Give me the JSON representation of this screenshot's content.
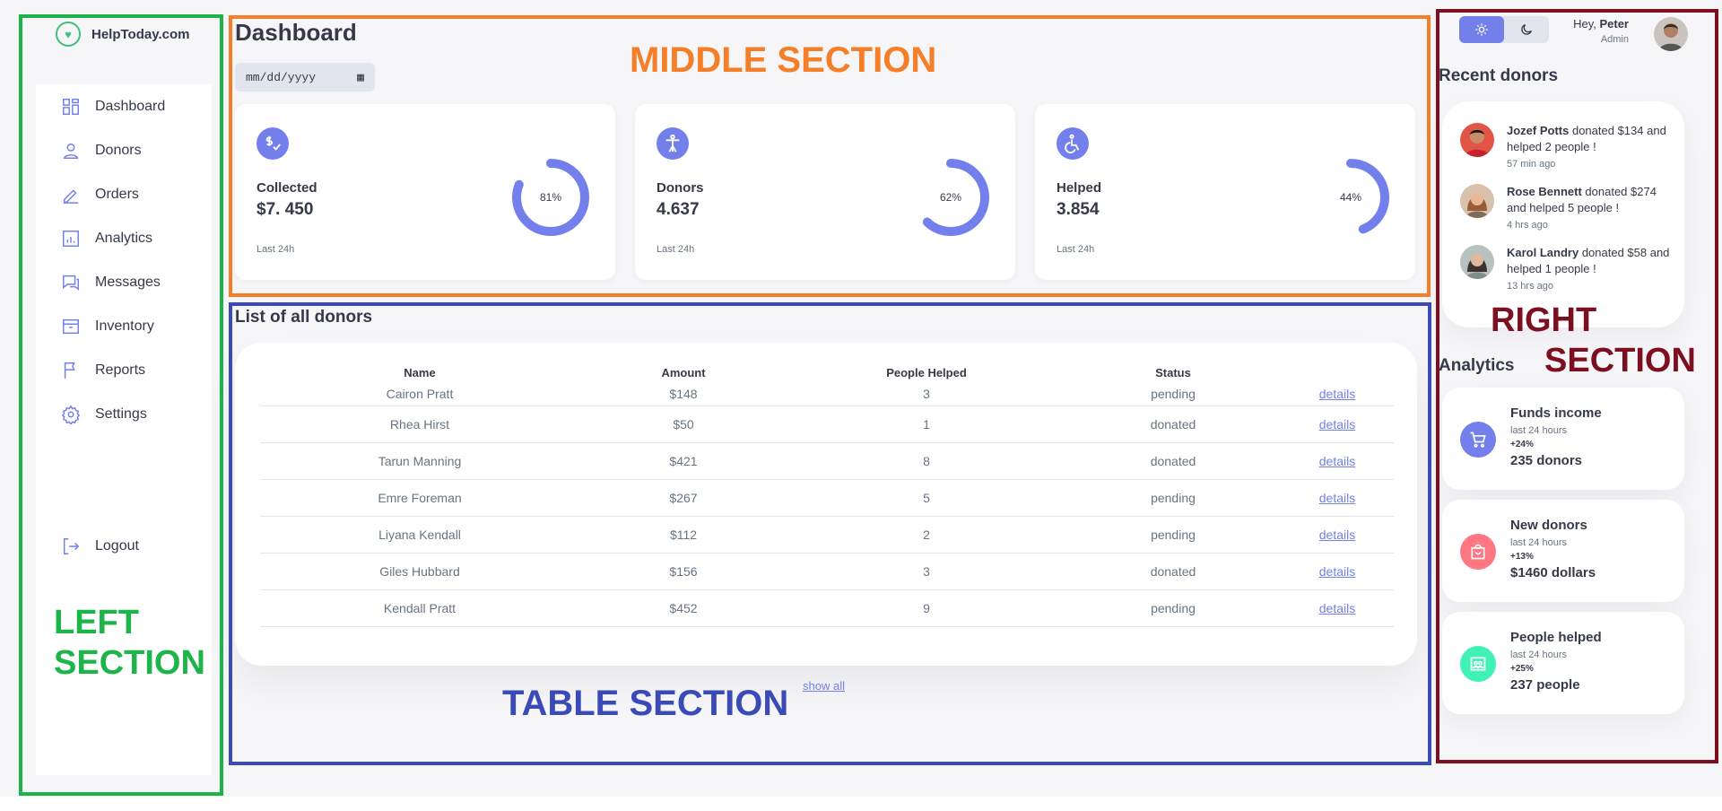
{
  "section_labels": {
    "left": "LEFT SECTION",
    "middle": "MIDDLE SECTION",
    "table": "TABLE SECTION",
    "right_line1": "RIGHT",
    "right_line2": "SECTION"
  },
  "brand": {
    "name": "HelpToday.com"
  },
  "sidebar": {
    "items": [
      {
        "label": "Dashboard",
        "icon": "grid-icon"
      },
      {
        "label": "Donors",
        "icon": "person-icon"
      },
      {
        "label": "Orders",
        "icon": "edit-icon"
      },
      {
        "label": "Analytics",
        "icon": "bar-chart-icon"
      },
      {
        "label": "Messages",
        "icon": "chat-icon"
      },
      {
        "label": "Inventory",
        "icon": "archive-icon"
      },
      {
        "label": "Reports",
        "icon": "flag-icon"
      },
      {
        "label": "Settings",
        "icon": "gear-icon"
      }
    ],
    "logout": "Logout"
  },
  "main": {
    "title": "Dashboard",
    "date_placeholder": "mm/dd/yyyy",
    "cards": [
      {
        "title": "Collected",
        "value": "$7. 450",
        "percent": 81,
        "percent_label": "81%",
        "footer": "Last 24h"
      },
      {
        "title": "Donors",
        "value": "4.637",
        "percent": 62,
        "percent_label": "62%",
        "footer": "Last 24h"
      },
      {
        "title": "Helped",
        "value": "3.854",
        "percent": 44,
        "percent_label": "44%",
        "footer": "Last 24h"
      }
    ]
  },
  "donors_table": {
    "title": "List of all donors",
    "headers": [
      "Name",
      "Amount",
      "People Helped",
      "Status",
      ""
    ],
    "rows": [
      {
        "name": "Cairon Pratt",
        "amount": "$148",
        "helped": "3",
        "status": "pending",
        "link": "details"
      },
      {
        "name": "Rhea Hirst",
        "amount": "$50",
        "helped": "1",
        "status": "donated",
        "link": "details"
      },
      {
        "name": "Tarun Manning",
        "amount": "$421",
        "helped": "8",
        "status": "donated",
        "link": "details"
      },
      {
        "name": "Emre Foreman",
        "amount": "$267",
        "helped": "5",
        "status": "pending",
        "link": "details"
      },
      {
        "name": "Liyana Kendall",
        "amount": "$112",
        "helped": "2",
        "status": "pending",
        "link": "details"
      },
      {
        "name": "Giles Hubbard",
        "amount": "$156",
        "helped": "3",
        "status": "donated",
        "link": "details"
      },
      {
        "name": "Kendall Pratt",
        "amount": "$452",
        "helped": "9",
        "status": "pending",
        "link": "details"
      }
    ],
    "show_all": "show all"
  },
  "user": {
    "greeting": "Hey,",
    "name": "Peter",
    "role": "Admin"
  },
  "recent": {
    "title": "Recent donors",
    "items": [
      {
        "name": "Jozef Potts",
        "text": "donated $134 and helped 2 people !",
        "time": "57 min ago"
      },
      {
        "name": "Rose Bennett",
        "text": "donated $274 and helped 5 people !",
        "time": "4 hrs ago"
      },
      {
        "name": "Karol Landry",
        "text": "donated $58 and helped 1 people !",
        "time": "13 hrs ago"
      }
    ]
  },
  "analytics": {
    "title": "Analytics",
    "cards": [
      {
        "title": "Funds income",
        "sub": "last 24 hours",
        "pct": "+24%",
        "value": "235 donors",
        "color": "#7380ec",
        "icon": "cart-icon"
      },
      {
        "title": "New donors",
        "sub": "last 24 hours",
        "pct": "+13%",
        "value": "$1460 dollars",
        "color": "#ff7782",
        "icon": "bag-icon"
      },
      {
        "title": "People helped",
        "sub": "last 24 hours",
        "pct": "+25%",
        "value": "237 people",
        "color": "#41f1b6",
        "icon": "people-icon"
      }
    ]
  },
  "colors": {
    "primary": "#7380ec",
    "danger": "#ff7782",
    "success": "#41f1b6"
  }
}
